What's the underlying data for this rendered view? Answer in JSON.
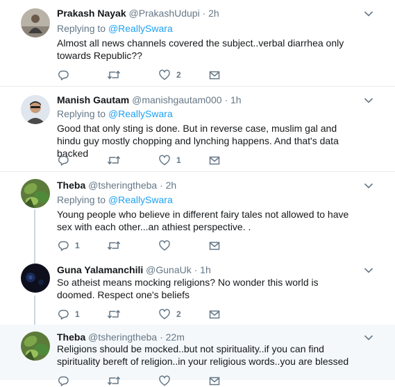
{
  "tweets": [
    {
      "name": "Prakash Nayak",
      "handle": "@PrakashUdupi",
      "time": "2h",
      "replying_prefix": "Replying to",
      "replying_to": "@ReallySwara",
      "text": "Almost all news channels covered the subject..verbal diarrhea only towards Republic??",
      "replies": "",
      "retweets": "",
      "likes": "2"
    },
    {
      "name": "Manish Gautam",
      "handle": "@manishgautam000",
      "time": "1h",
      "replying_prefix": "Replying to",
      "replying_to": "@ReallySwara",
      "text": "Good that only sting is done. But in reverse case, muslim gal and hindu guy mostly chopping and lynching happens. And that's data backed",
      "replies": "",
      "retweets": "",
      "likes": "1"
    },
    {
      "name": "Theba",
      "handle": "@tsheringtheba",
      "time": "2h",
      "replying_prefix": "Replying to",
      "replying_to": "@ReallySwara",
      "text": "Young people who believe in different fairy tales not allowed to have sex with each other...an athiest perspective. .",
      "replies": "1",
      "retweets": "",
      "likes": ""
    },
    {
      "name": "Guna Yalamanchili",
      "handle": "@GunaUk",
      "time": "1h",
      "text": "So atheist means mocking religions? No wonder this world is doomed. Respect one's beliefs",
      "replies": "1",
      "retweets": "",
      "likes": "2"
    },
    {
      "name": "Theba",
      "handle": "@tsheringtheba",
      "time": "22m",
      "text": "Religions should be mocked..but not spirituality..if you can find spirituality bereft of religion..in your religious words..you are blessed",
      "replies": "",
      "retweets": "",
      "likes": ""
    }
  ],
  "separator_dot": "·",
  "colors": {
    "text": "#14171a",
    "secondary": "#657786",
    "link": "#1da1f2",
    "border": "#e6ecf0",
    "thread_line": "#ccd6dd",
    "highlight_bg": "#f5f8fa"
  }
}
